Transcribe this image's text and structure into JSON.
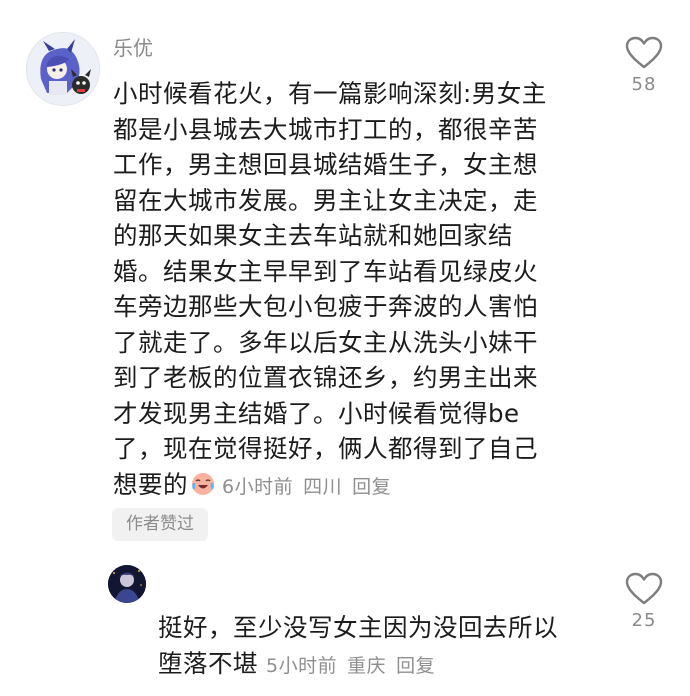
{
  "comment": {
    "username": "乐优",
    "lines": [
      "小时候看花火，有一篇影响深刻:男女主",
      "都是小县城去大城市打工的，都很辛苦",
      "工作，男主想回县城结婚生子，女主想",
      "留在大城市发展。男主让女主决定，走",
      "的那天如果女主去车站就和她回家结",
      "婚。结果女主早早到了车站看见绿皮火",
      "车旁边那些大包小包疲于奔波的人害怕",
      "了就走了。多年以后女主从洗头小妹干",
      "到了老板的位置衣锦还乡，约男主出来",
      "才发现男主结婚了。小时候看觉得be",
      "了，现在觉得挺好，俩人都得到了自己"
    ],
    "last_line": "想要的",
    "emoji": "crying-laughing-emoji",
    "time": "6小时前",
    "location": "四川",
    "reply_label": "回复",
    "like_count": "58",
    "author_liked_badge": "作者赞过"
  },
  "reply": {
    "lines": [
      "挺好，至少没写女主因为没回去所以"
    ],
    "last_line": "堕落不堪",
    "time": "5小时前",
    "location": "重庆",
    "reply_label": "回复",
    "like_count": "25"
  },
  "colors": {
    "text": "#1c1c1c",
    "meta": "#8f8f8f",
    "badge_bg": "#f1f1f1"
  }
}
